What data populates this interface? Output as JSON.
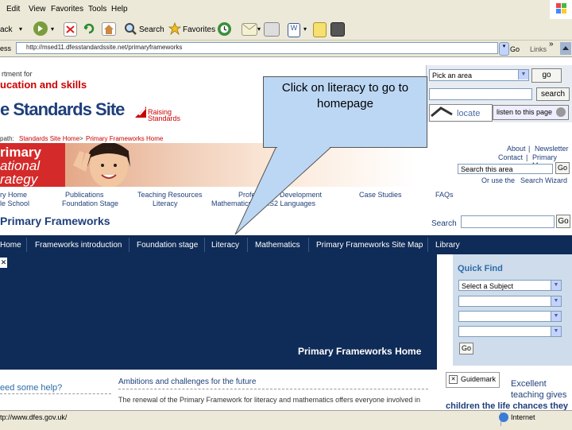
{
  "menu": {
    "edit": "Edit",
    "view": "View",
    "favorites": "Favorites",
    "tools": "Tools",
    "help": "Help"
  },
  "toolbar": {
    "back_label": "ack",
    "search_label": "Search",
    "favorites_label": "Favorites",
    "go_label": "Go",
    "links_label": "Links",
    "chevron": "»"
  },
  "address_bar": {
    "label": "ess",
    "url": "http://msed11.dfesstandardssite.net/primaryframeworks"
  },
  "header": {
    "dfes_line1": "rtment for",
    "dfes_line2": "ucation and skills",
    "site_title": "e Standards Site",
    "raising_line1": "Raising",
    "raising_line2": "Standards"
  },
  "right_panel": {
    "area_select": "Pick an area",
    "go_label": "go",
    "search_label": "search",
    "locate_label": "locate",
    "listen_label": "listen to this page"
  },
  "breadcrumb": {
    "prefix": "path:",
    "home": "Standards Site Home",
    "sep": ">",
    "current": "Primary Frameworks Home"
  },
  "banner": {
    "line1": "rimary",
    "line2": "ational",
    "line3": "rategy",
    "about": "About",
    "newsletter": "Newsletter",
    "contact": "Contact",
    "primary_map": "Primary Map",
    "search_area_value": "Search this area",
    "go_label": "Go",
    "or_use": "Or use the",
    "search_wizard": "Search Wizard"
  },
  "topnav": {
    "primary_home": "ry Home",
    "school": "le School",
    "publications": "Publications",
    "foundation_stage": "Foundation Stage",
    "teaching_resources": "Teaching Resources",
    "literacy": "Literacy",
    "mathematics": "Mathematics",
    "professional_dev": "Professional Development",
    "ks2_languages": "KS2 Languages",
    "case_studies": "Case Studies",
    "faqs": "FAQs"
  },
  "frameworks_heading": "Primary Frameworks",
  "frameworks_search_label": "Search",
  "frameworks_go": "Go",
  "nav": {
    "home": "Home",
    "intro": "Frameworks introduction",
    "foundation": "Foundation stage",
    "literacy": "Literacy",
    "mathematics": "Mathematics",
    "sitemap": "Primary Frameworks Site Map",
    "library": "Library"
  },
  "hero": {
    "title": "Primary Frameworks Home",
    "close": "✕"
  },
  "quick_find": {
    "title": "Quick Find",
    "subject_select": "Select a Subject",
    "go_label": "Go"
  },
  "content": {
    "help": "eed some help?",
    "ambitions_heading": "Ambitions and challenges for the future",
    "renewal_text": "The renewal of the Primary Framework for literacy and mathematics offers everyone involved in",
    "guidemark": "Guidemark",
    "excellent_line1": "Excellent",
    "excellent_line2": "teaching gives",
    "children_line": "children the life chances they"
  },
  "callout": {
    "text": "Click on literacy to go to homepage"
  },
  "status": {
    "url": "tp://www.dfes.gov.uk/",
    "zone": "Internet"
  },
  "colors": {
    "navy": "#0f2b57",
    "callout": "#bcd7f4",
    "dfes_red": "#cc0000",
    "title_blue": "#1f3f7a"
  }
}
